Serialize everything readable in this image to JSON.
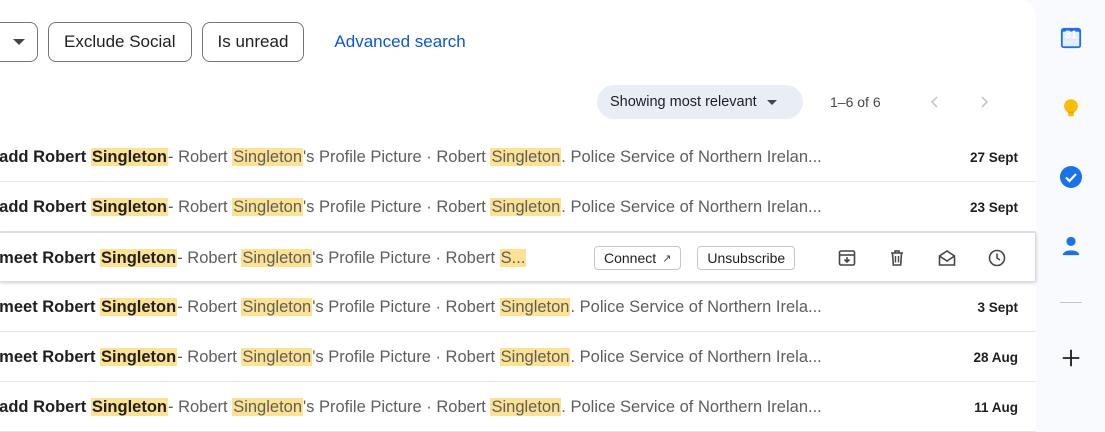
{
  "filters": {
    "chips": [
      "Exclude Social",
      "Is unread"
    ],
    "advanced_search": "Advanced search"
  },
  "toolbar": {
    "sort_label": "Showing most relevant",
    "page_count": "1–6 of 6"
  },
  "emails": [
    {
      "prefix": ", add Robert ",
      "date": "27 Sept",
      "snippet_end": ". Police Service of Northern Irelan..."
    },
    {
      "prefix": ", add Robert ",
      "date": "23 Sept",
      "snippet_end": ". Police Service of Northern Irelan..."
    },
    {
      "prefix": ", meet Robert ",
      "date": "",
      "snippet_end": ""
    },
    {
      "prefix": ", meet Robert ",
      "date": "3 Sept",
      "snippet_end": ". Police Service of Northern Irela..."
    },
    {
      "prefix": ", meet Robert ",
      "date": "28 Aug",
      "snippet_end": ". Police Service of Northern Irela..."
    },
    {
      "prefix": ", add Robert ",
      "date": "11 Aug",
      "snippet_end": ". Police Service of Northern Irelan..."
    }
  ],
  "highlight": "Singleton",
  "snippet": {
    "dash": " - Robert ",
    "profile": "'s Profile Picture · Robert ",
    "truncated_s": "S..."
  },
  "hover_actions": {
    "connect": "Connect",
    "unsubscribe": "Unsubscribe"
  },
  "side_panel": {
    "calendar_day": "31"
  },
  "colors": {
    "highlight": "#fde293",
    "link": "#0b57d0",
    "calendar": "#1a73e8",
    "keep": "#fbbc04",
    "tasks": "#1a73e8",
    "contacts": "#1a73e8"
  }
}
